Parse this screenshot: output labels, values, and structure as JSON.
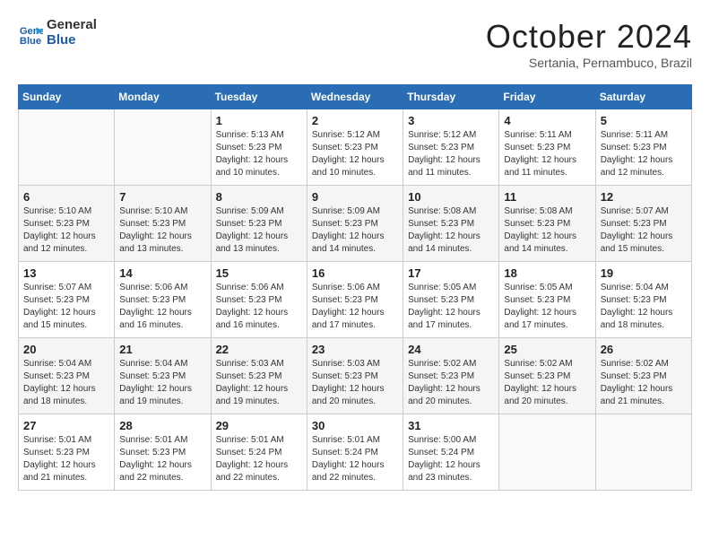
{
  "header": {
    "logo_line1": "General",
    "logo_line2": "Blue",
    "month": "October 2024",
    "location": "Sertania, Pernambuco, Brazil"
  },
  "weekdays": [
    "Sunday",
    "Monday",
    "Tuesday",
    "Wednesday",
    "Thursday",
    "Friday",
    "Saturday"
  ],
  "weeks": [
    [
      {
        "day": "",
        "info": ""
      },
      {
        "day": "",
        "info": ""
      },
      {
        "day": "1",
        "info": "Sunrise: 5:13 AM\nSunset: 5:23 PM\nDaylight: 12 hours\nand 10 minutes."
      },
      {
        "day": "2",
        "info": "Sunrise: 5:12 AM\nSunset: 5:23 PM\nDaylight: 12 hours\nand 10 minutes."
      },
      {
        "day": "3",
        "info": "Sunrise: 5:12 AM\nSunset: 5:23 PM\nDaylight: 12 hours\nand 11 minutes."
      },
      {
        "day": "4",
        "info": "Sunrise: 5:11 AM\nSunset: 5:23 PM\nDaylight: 12 hours\nand 11 minutes."
      },
      {
        "day": "5",
        "info": "Sunrise: 5:11 AM\nSunset: 5:23 PM\nDaylight: 12 hours\nand 12 minutes."
      }
    ],
    [
      {
        "day": "6",
        "info": "Sunrise: 5:10 AM\nSunset: 5:23 PM\nDaylight: 12 hours\nand 12 minutes."
      },
      {
        "day": "7",
        "info": "Sunrise: 5:10 AM\nSunset: 5:23 PM\nDaylight: 12 hours\nand 13 minutes."
      },
      {
        "day": "8",
        "info": "Sunrise: 5:09 AM\nSunset: 5:23 PM\nDaylight: 12 hours\nand 13 minutes."
      },
      {
        "day": "9",
        "info": "Sunrise: 5:09 AM\nSunset: 5:23 PM\nDaylight: 12 hours\nand 14 minutes."
      },
      {
        "day": "10",
        "info": "Sunrise: 5:08 AM\nSunset: 5:23 PM\nDaylight: 12 hours\nand 14 minutes."
      },
      {
        "day": "11",
        "info": "Sunrise: 5:08 AM\nSunset: 5:23 PM\nDaylight: 12 hours\nand 14 minutes."
      },
      {
        "day": "12",
        "info": "Sunrise: 5:07 AM\nSunset: 5:23 PM\nDaylight: 12 hours\nand 15 minutes."
      }
    ],
    [
      {
        "day": "13",
        "info": "Sunrise: 5:07 AM\nSunset: 5:23 PM\nDaylight: 12 hours\nand 15 minutes."
      },
      {
        "day": "14",
        "info": "Sunrise: 5:06 AM\nSunset: 5:23 PM\nDaylight: 12 hours\nand 16 minutes."
      },
      {
        "day": "15",
        "info": "Sunrise: 5:06 AM\nSunset: 5:23 PM\nDaylight: 12 hours\nand 16 minutes."
      },
      {
        "day": "16",
        "info": "Sunrise: 5:06 AM\nSunset: 5:23 PM\nDaylight: 12 hours\nand 17 minutes."
      },
      {
        "day": "17",
        "info": "Sunrise: 5:05 AM\nSunset: 5:23 PM\nDaylight: 12 hours\nand 17 minutes."
      },
      {
        "day": "18",
        "info": "Sunrise: 5:05 AM\nSunset: 5:23 PM\nDaylight: 12 hours\nand 17 minutes."
      },
      {
        "day": "19",
        "info": "Sunrise: 5:04 AM\nSunset: 5:23 PM\nDaylight: 12 hours\nand 18 minutes."
      }
    ],
    [
      {
        "day": "20",
        "info": "Sunrise: 5:04 AM\nSunset: 5:23 PM\nDaylight: 12 hours\nand 18 minutes."
      },
      {
        "day": "21",
        "info": "Sunrise: 5:04 AM\nSunset: 5:23 PM\nDaylight: 12 hours\nand 19 minutes."
      },
      {
        "day": "22",
        "info": "Sunrise: 5:03 AM\nSunset: 5:23 PM\nDaylight: 12 hours\nand 19 minutes."
      },
      {
        "day": "23",
        "info": "Sunrise: 5:03 AM\nSunset: 5:23 PM\nDaylight: 12 hours\nand 20 minutes."
      },
      {
        "day": "24",
        "info": "Sunrise: 5:02 AM\nSunset: 5:23 PM\nDaylight: 12 hours\nand 20 minutes."
      },
      {
        "day": "25",
        "info": "Sunrise: 5:02 AM\nSunset: 5:23 PM\nDaylight: 12 hours\nand 20 minutes."
      },
      {
        "day": "26",
        "info": "Sunrise: 5:02 AM\nSunset: 5:23 PM\nDaylight: 12 hours\nand 21 minutes."
      }
    ],
    [
      {
        "day": "27",
        "info": "Sunrise: 5:01 AM\nSunset: 5:23 PM\nDaylight: 12 hours\nand 21 minutes."
      },
      {
        "day": "28",
        "info": "Sunrise: 5:01 AM\nSunset: 5:23 PM\nDaylight: 12 hours\nand 22 minutes."
      },
      {
        "day": "29",
        "info": "Sunrise: 5:01 AM\nSunset: 5:24 PM\nDaylight: 12 hours\nand 22 minutes."
      },
      {
        "day": "30",
        "info": "Sunrise: 5:01 AM\nSunset: 5:24 PM\nDaylight: 12 hours\nand 22 minutes."
      },
      {
        "day": "31",
        "info": "Sunrise: 5:00 AM\nSunset: 5:24 PM\nDaylight: 12 hours\nand 23 minutes."
      },
      {
        "day": "",
        "info": ""
      },
      {
        "day": "",
        "info": ""
      }
    ]
  ]
}
